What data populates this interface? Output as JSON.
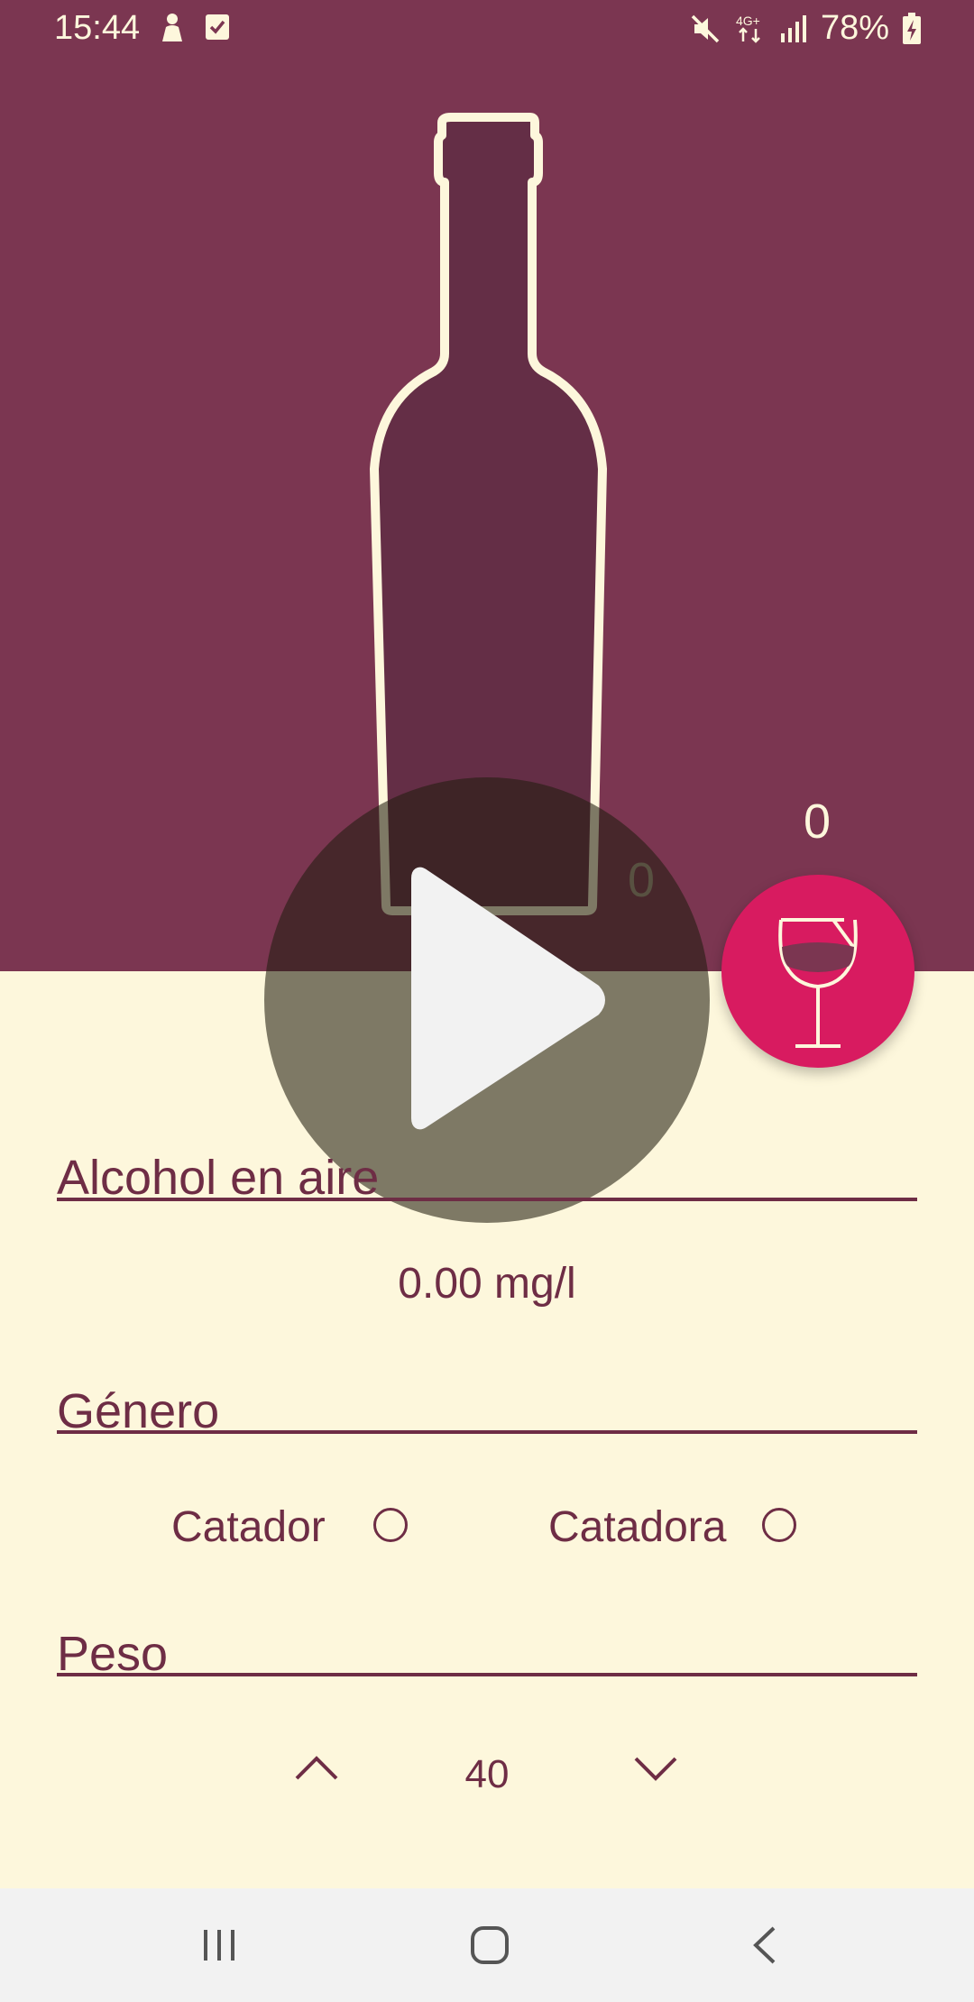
{
  "status_bar": {
    "time": "15:44",
    "battery": "78%",
    "network": "4G+",
    "icons": [
      "person-icon",
      "check-box-icon",
      "mute-icon",
      "network-4g-icon",
      "signal-icon",
      "battery-charging-icon"
    ]
  },
  "bottle": {
    "count": "0",
    "fill_level": 0
  },
  "fab": {
    "count": "0",
    "icon": "wine-glass-icon"
  },
  "overlay": {
    "icon": "play-icon"
  },
  "alcohol": {
    "title": "Alcohol en aire",
    "value": "0.00 mg/l"
  },
  "gender": {
    "title": "Género",
    "options": [
      {
        "label": "Catador",
        "selected": false
      },
      {
        "label": "Catadora",
        "selected": false
      }
    ]
  },
  "weight": {
    "title": "Peso",
    "value": "40",
    "up_icon": "chevron-up-icon",
    "down_icon": "chevron-down-icon"
  },
  "nav": {
    "icons": [
      "recents-icon",
      "home-icon",
      "back-icon"
    ]
  },
  "colors": {
    "header": "#7b3651",
    "background": "#fdf7dc",
    "accent": "#d81b60",
    "text": "#6e2d45"
  }
}
